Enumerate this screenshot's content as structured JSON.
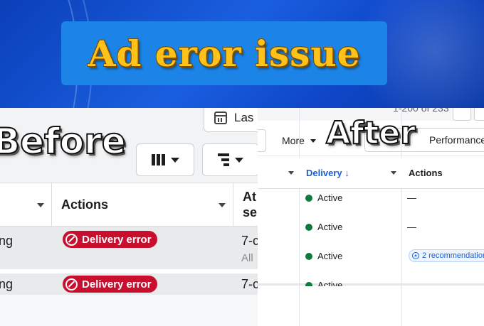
{
  "banner": {
    "title": "Ad eror issue"
  },
  "before": {
    "label": "Before",
    "date_button": "Las",
    "table": {
      "columns": [
        "Actions",
        "At se"
      ],
      "rows": [
        {
          "name_tail": "ng",
          "action": "Delivery error",
          "attr": "7-c",
          "attr_sub": "All"
        },
        {
          "name_tail": "ng",
          "action": "Delivery error",
          "attr": "7-c"
        }
      ]
    }
  },
  "after": {
    "label": "After",
    "pager": "1-200 of 233",
    "toolbar": {
      "more": "More",
      "performance": "Performance"
    },
    "table": {
      "columns": [
        "Delivery ↓",
        "Actions"
      ],
      "rows": [
        {
          "status": "Active",
          "action": "—"
        },
        {
          "status": "Active",
          "action": "—"
        },
        {
          "status": "Active",
          "action": "2 recommendation"
        },
        {
          "status": "Active",
          "action": ""
        }
      ]
    }
  },
  "colors": {
    "error": "#c8102e",
    "active": "#0f7a3d",
    "banner": "#1a5fe0",
    "title": "#ffc21a"
  }
}
